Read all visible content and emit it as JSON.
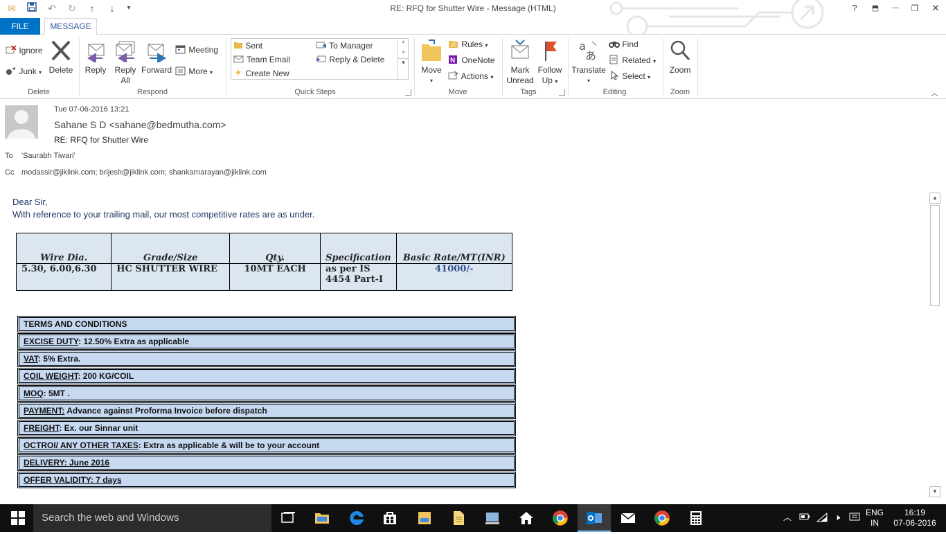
{
  "window": {
    "title": "RE: RFQ for Shutter Wire - Message (HTML)",
    "help": "?",
    "restore_ribbon": "⬒",
    "minimize": "—",
    "maximize": "❐",
    "close": "✕"
  },
  "tabs": {
    "file": "FILE",
    "message": "MESSAGE"
  },
  "ribbon": {
    "delete_group": {
      "label": "Delete",
      "ignore": "Ignore",
      "junk": "Junk",
      "delete": "Delete"
    },
    "respond_group": {
      "label": "Respond",
      "reply": "Reply",
      "reply_all_1": "Reply",
      "reply_all_2": "All",
      "forward": "Forward",
      "meeting": "Meeting",
      "more": "More"
    },
    "quick_steps": {
      "label": "Quick Steps",
      "items": [
        "Sent",
        "To Manager",
        "Team Email",
        "Reply & Delete",
        "Create New"
      ]
    },
    "move_group": {
      "label": "Move",
      "move": "Move",
      "rules": "Rules",
      "onenote": "OneNote",
      "actions": "Actions"
    },
    "tags_group": {
      "label": "Tags",
      "mark_unread_1": "Mark",
      "mark_unread_2": "Unread",
      "follow_up_1": "Follow",
      "follow_up_2": "Up"
    },
    "editing_group": {
      "label": "Editing",
      "translate": "Translate",
      "find": "Find",
      "related": "Related",
      "select": "Select"
    },
    "zoom_group": {
      "label": "Zoom",
      "zoom": "Zoom"
    }
  },
  "message": {
    "date": "Tue 07-06-2016 13:21",
    "sender": "Sahane S D  <sahane@bedmutha.com>",
    "subject": "RE: RFQ for Shutter Wire",
    "to_label": "To",
    "to": "'Saurabh Tiwari'",
    "cc_label": "Cc",
    "cc": "modassir@jiklink.com; brijesh@jiklink.com; shankarnarayan@jiklink.com"
  },
  "body": {
    "greeting": "Dear Sir,",
    "intro": "With reference to your trailing mail, our most competitive rates are as under.",
    "rates_table": {
      "headers": [
        "Wire Dia.",
        "Grade/Size",
        "Qty.",
        "Specification",
        "Basic Rate/MT(INR)"
      ],
      "row": [
        "5.30, 6.00,6.30",
        "HC SHUTTER WIRE",
        "10MT EACH",
        "as per IS 4454 Part-I",
        "41000/-"
      ]
    },
    "terms": [
      {
        "key": "TERMS AND CONDITIONS",
        "value": ""
      },
      {
        "key": "EXCISE DUTY",
        "value": ": 12.50% Extra as applicable"
      },
      {
        "key": "VAT",
        "value": ": 5%  Extra."
      },
      {
        "key": "COIL WEIGHT",
        "value": ": 200 KG/COIL"
      },
      {
        "key": "MOQ",
        "value": ": 5MT ."
      },
      {
        "key": "PAYMENT:",
        "value": " Advance against Proforma Invoice before dispatch"
      },
      {
        "key": "FREIGHT",
        "value": ": Ex. our Sinnar unit"
      },
      {
        "key": "OCTROI/ ANY OTHER TAXES",
        "value": ": Extra as applicable & will be to your account"
      },
      {
        "key": "DELIVERY: June 2016",
        "value": ""
      },
      {
        "key": "OFFER VALIDITY:  7 days",
        "value": ""
      }
    ]
  },
  "taskbar": {
    "search_placeholder": "Search the web and Windows",
    "lang_1": "ENG",
    "lang_2": "IN",
    "time": "16:19",
    "date": "07-06-2016"
  },
  "colors": {
    "accent": "#0072c6",
    "table_bg": "#dce6f1",
    "terms_bg": "#c6d9f1",
    "body_text": "#1f3864"
  }
}
